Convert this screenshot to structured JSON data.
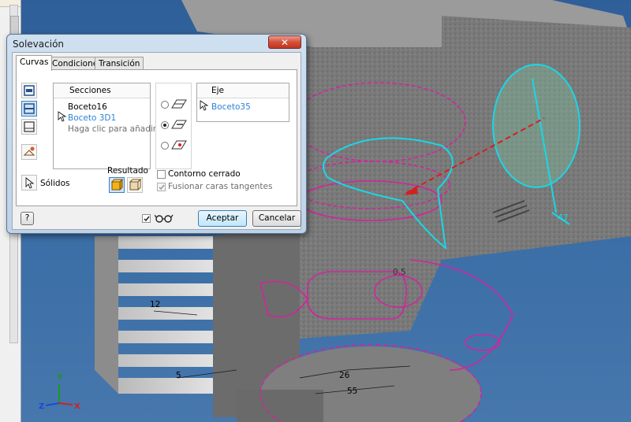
{
  "dialog": {
    "title": "Solevación",
    "close_glyph": "✕",
    "tabs": [
      "Curvas",
      "Condiciones",
      "Transición"
    ],
    "sections": {
      "header": "Secciones",
      "items": [
        "Boceto16",
        "Boceto 3D1",
        "Haga clic para añadir"
      ]
    },
    "rail": {
      "header": "Eje",
      "items": [
        "Boceto35"
      ]
    },
    "solids_label": "Sólidos",
    "result_label": "Resultado",
    "closed_contour_label": "Contorno cerrado",
    "merge_faces_label": "Fusionar caras tangentes",
    "accept_label": "Aceptar",
    "cancel_label": "Cancelar",
    "help_glyph": "?"
  },
  "viewport": {
    "dimensions": [
      "47",
      "12",
      "5",
      "26",
      "55",
      "0.5"
    ],
    "triad": {
      "x": "X",
      "y": "Y",
      "z": "Z"
    }
  },
  "colors": {
    "sketch": "#d3249e",
    "loft_profile": "#19d7e6",
    "axis": "#d42020",
    "dialog_accent": "#2b83d6"
  }
}
